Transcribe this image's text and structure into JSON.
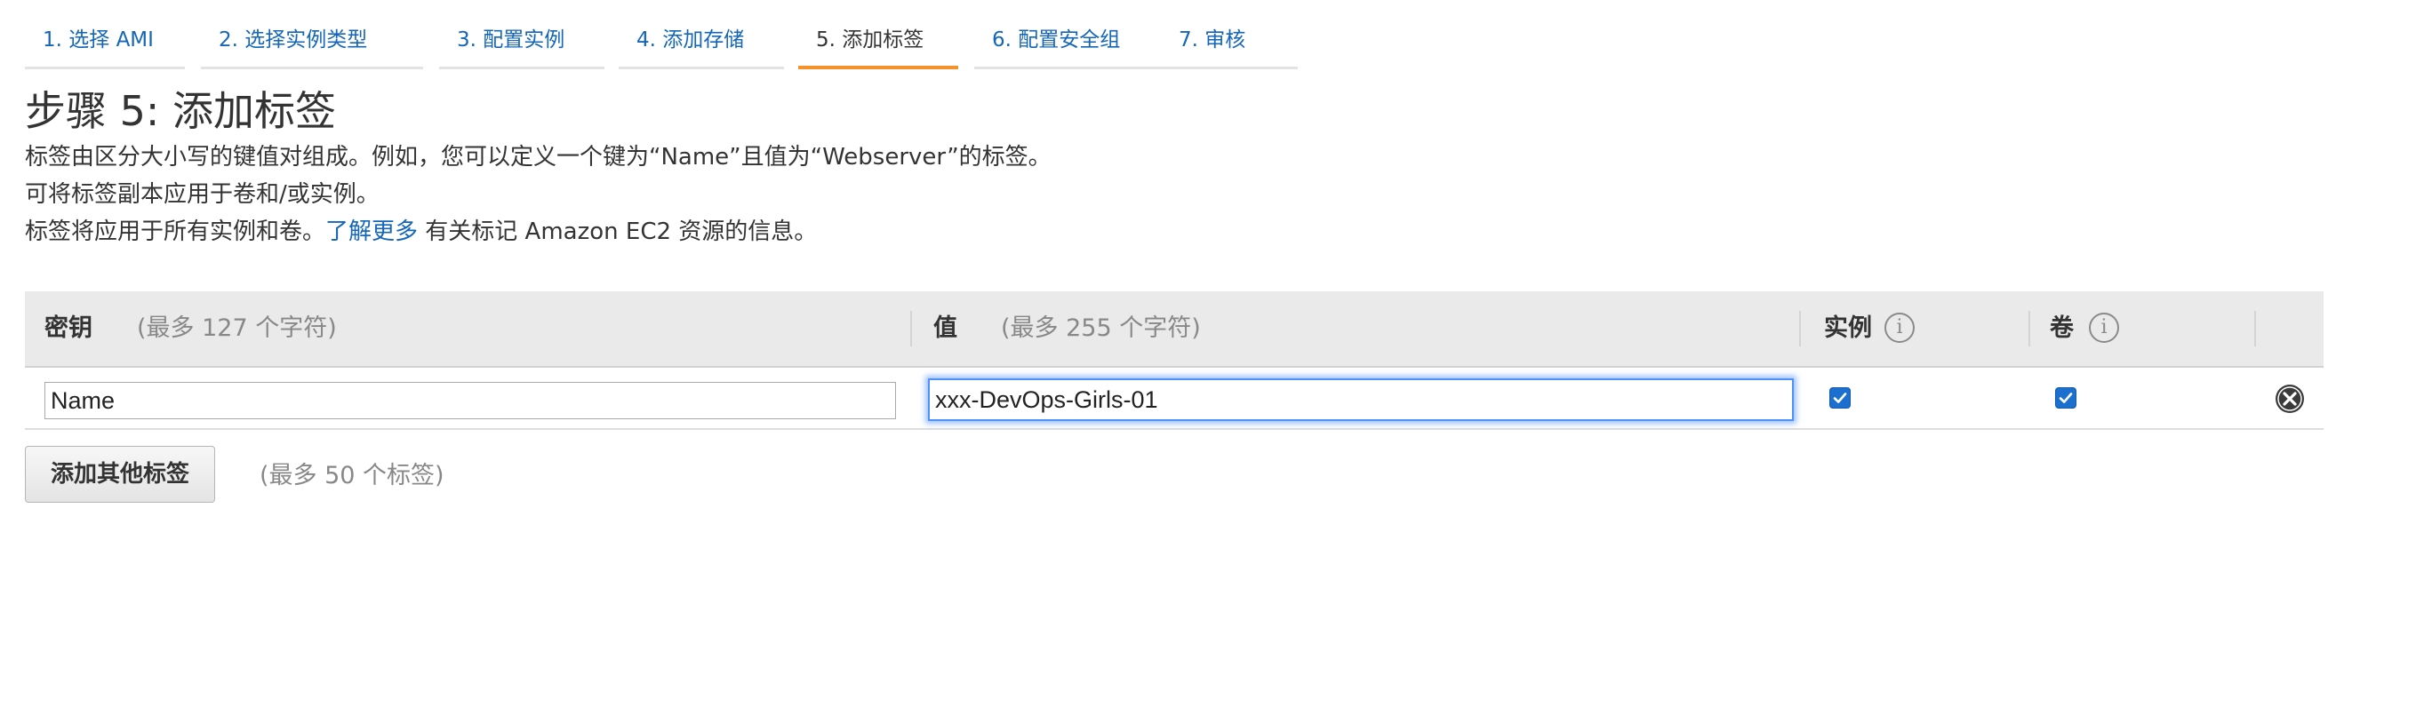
{
  "tabs": [
    {
      "label": "1. 选择 AMI",
      "active": false
    },
    {
      "label": "2. 选择实例类型",
      "active": false
    },
    {
      "label": "3. 配置实例",
      "active": false
    },
    {
      "label": "4. 添加存储",
      "active": false
    },
    {
      "label": "5. 添加标签",
      "active": true
    },
    {
      "label": "6. 配置安全组",
      "active": false
    },
    {
      "label": "7. 审核",
      "active": false
    }
  ],
  "page": {
    "title": "步骤 5: 添加标签",
    "desc_line1": "标签由区分大小写的键值对组成。例如，您可以定义一个键为“Name”且值为“Webserver”的标签。",
    "desc_line2": "可将标签副本应用于卷和/或实例。",
    "desc_line3_prefix": "标签将应用于所有实例和卷。",
    "learn_more_link": "了解更多",
    "desc_line3_suffix": " 有关标记 Amazon EC2 资源的信息。"
  },
  "table": {
    "columns": {
      "key_label": "密钥",
      "key_hint": "(最多 127 个字符)",
      "value_label": "值",
      "value_hint": "(最多 255 个字符)",
      "instance_label": "实例",
      "volume_label": "卷",
      "info_glyph": "i"
    },
    "rows": [
      {
        "key": "Name",
        "value": "xxx-DevOps-Girls-01",
        "instance_checked": true,
        "volume_checked": true
      }
    ]
  },
  "actions": {
    "add_tag_label": "添加其他标签",
    "add_tag_hint": "(最多 50 个标签)"
  },
  "colors": {
    "link": "#1466b8",
    "active_tab_underline": "#f5922a",
    "checkbox": "#1a6fcf",
    "focus_ring": "#4d90fe",
    "header_bg": "#eaeaea"
  },
  "icons": {
    "info": "info-icon",
    "checkbox_checked": "checkmark-icon",
    "remove": "close-circle-icon"
  }
}
